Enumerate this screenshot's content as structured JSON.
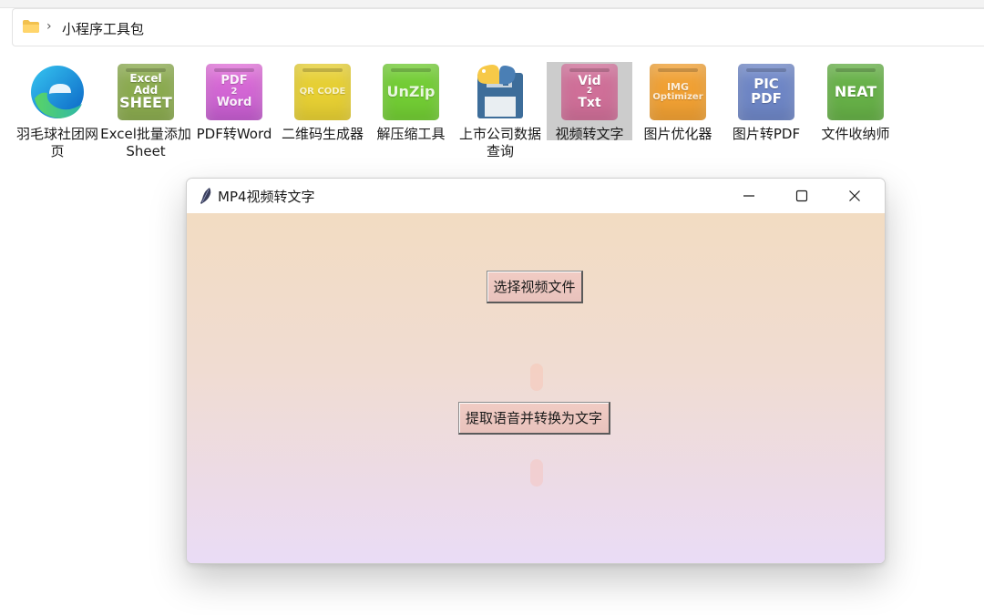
{
  "explorer": {
    "breadcrumb": "小程序工具包",
    "items": [
      {
        "label": "羽毛球社团网页",
        "icon": "edge-browser-icon"
      },
      {
        "label": "Excel批量添加Sheet",
        "icon": "excel-add-sheet-icon",
        "tile_text": [
          "Excel",
          "Add",
          "SHEET"
        ],
        "color": "#8bab4f"
      },
      {
        "label": "PDF转Word",
        "icon": "pdf-to-word-icon",
        "tile_text": [
          "PDF",
          "2",
          "Word"
        ],
        "color": "#d96ad8"
      },
      {
        "label": "二维码生成器",
        "icon": "qr-code-icon",
        "tile_text": [
          "QR CODE"
        ],
        "color": "#e6cf33"
      },
      {
        "label": "解压缩工具",
        "icon": "unzip-icon",
        "tile_text": [
          "UnZip"
        ],
        "color": "#72cc34"
      },
      {
        "label": "上市公司数据查询",
        "icon": "python-floppy-icon"
      },
      {
        "label": "视频转文字",
        "icon": "video-to-text-icon",
        "tile_text": [
          "Vid",
          "2",
          "Txt"
        ],
        "color": "#cf6f98",
        "selected": true
      },
      {
        "label": "图片优化器",
        "icon": "img-optimizer-icon",
        "tile_text": [
          "IMG",
          "Optimizer"
        ],
        "color": "#f0a033"
      },
      {
        "label": "图片转PDF",
        "icon": "pic-pdf-icon",
        "tile_text": [
          "PIC",
          "PDF"
        ],
        "color": "#6e86c6"
      },
      {
        "label": "文件收纳师",
        "icon": "neat-icon",
        "tile_text": [
          "NEAT"
        ],
        "color": "#66b047"
      }
    ]
  },
  "window": {
    "title": "MP4视频转文字",
    "buttons": {
      "select": "选择视频文件",
      "convert": "提取语音并转换为文字"
    }
  }
}
